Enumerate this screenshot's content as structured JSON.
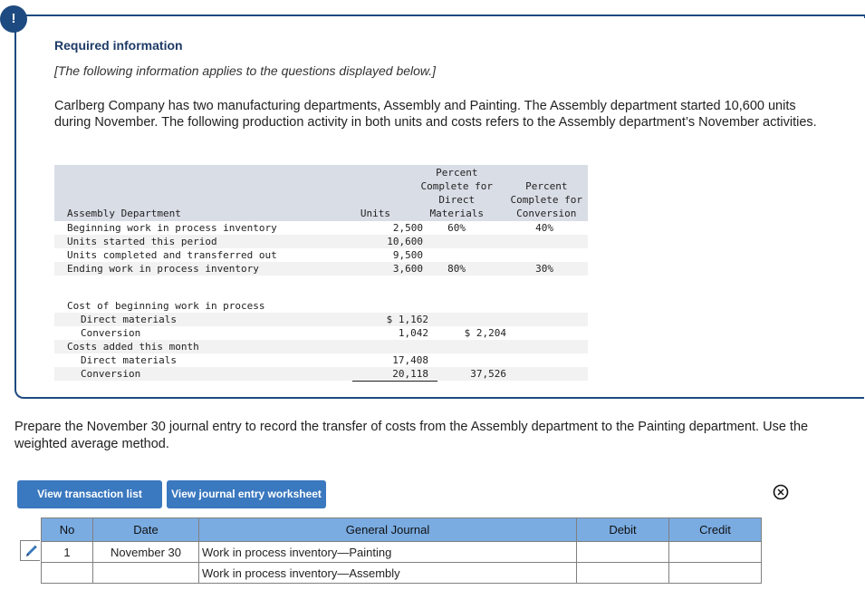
{
  "alert": {
    "icon": "!"
  },
  "info": {
    "title": "Required information",
    "subtitle": "[The following information applies to the questions displayed below.]",
    "intro": "Carlberg Company has two manufacturing departments, Assembly and Painting. The Assembly department started 10,600 units during November. The following production activity in both units and costs refers to the Assembly department’s November activities."
  },
  "table": {
    "header": {
      "label": "Assembly Department",
      "units": "Units",
      "dm": "Percent\nComplete for\nDirect\nMaterials",
      "conv": "Percent\nComplete for\nConversion"
    },
    "unit_rows": [
      {
        "label": "Beginning work in process inventory",
        "units": "2,500",
        "dm": "60%",
        "conv": "40%"
      },
      {
        "label": "Units started this period",
        "units": "10,600",
        "dm": "",
        "conv": ""
      },
      {
        "label": "Units completed and transferred out",
        "units": "9,500",
        "dm": "",
        "conv": ""
      },
      {
        "label": "Ending work in process inventory",
        "units": "3,600",
        "dm": "80%",
        "conv": "30%"
      }
    ],
    "cost_rows": [
      {
        "label": "Cost of beginning work in process",
        "c1": "",
        "c2": ""
      },
      {
        "label": "Direct materials",
        "c1": "$ 1,162",
        "c2": ""
      },
      {
        "label": "Conversion",
        "c1": "1,042",
        "c2": "$ 2,204"
      },
      {
        "label": "Costs added this month",
        "c1": "",
        "c2": ""
      },
      {
        "label": "Direct materials",
        "c1": "17,408",
        "c2": ""
      },
      {
        "label": "Conversion",
        "c1": "20,118",
        "c2": "37,526"
      }
    ]
  },
  "prompt": "Prepare the November 30 journal entry to record the transfer of costs from the Assembly department to the Painting department. Use the weighted average method.",
  "buttons": {
    "transaction_list": "View transaction list",
    "journal_worksheet": "View journal entry worksheet"
  },
  "journal": {
    "headers": {
      "no": "No",
      "date": "Date",
      "general_journal": "General Journal",
      "debit": "Debit",
      "credit": "Credit"
    },
    "rows": [
      {
        "no": "1",
        "date": "November 30",
        "account": "Work in process inventory—Painting",
        "debit": "",
        "credit": ""
      },
      {
        "no": "",
        "date": "",
        "account": "Work in process inventory—Assembly",
        "debit": "",
        "credit": ""
      }
    ]
  },
  "colors": {
    "accent": "#1d4a80",
    "button": "#3a78bf",
    "table_header": "#7aace2"
  }
}
